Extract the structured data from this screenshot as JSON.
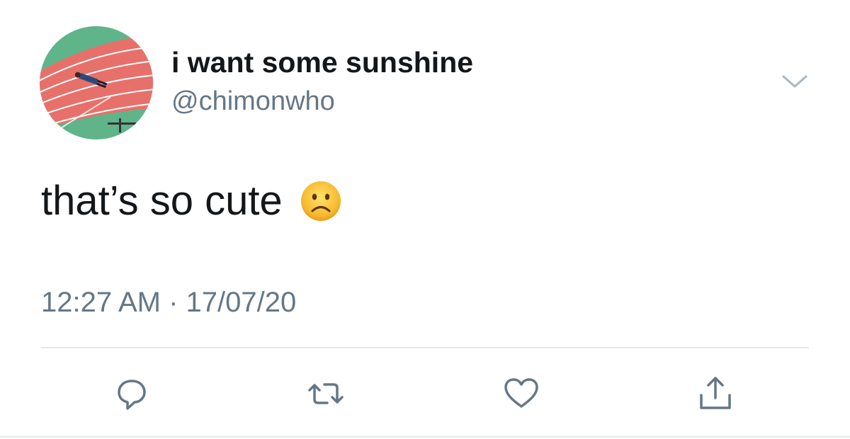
{
  "user": {
    "display_name": "i want some sunshine",
    "handle": "@chimonwho",
    "avatar_icon": "avatar-running-track-photo"
  },
  "tweet": {
    "text": "that’s so cute",
    "emoji_icon": "frowning-face-emoji",
    "timestamp": "12:27 AM · 17/07/20"
  },
  "actions": {
    "reply_icon": "reply-icon",
    "retweet_icon": "retweet-icon",
    "like_icon": "heart-icon",
    "share_icon": "share-icon"
  },
  "menu": {
    "caret_icon": "chevron-down-icon"
  },
  "colors": {
    "primary_text": "#14171a",
    "secondary_text": "#657786",
    "icon": "#657786",
    "divider": "#e1e8ed",
    "track_red": "#e8706a",
    "field_green": "#5fb48a"
  }
}
